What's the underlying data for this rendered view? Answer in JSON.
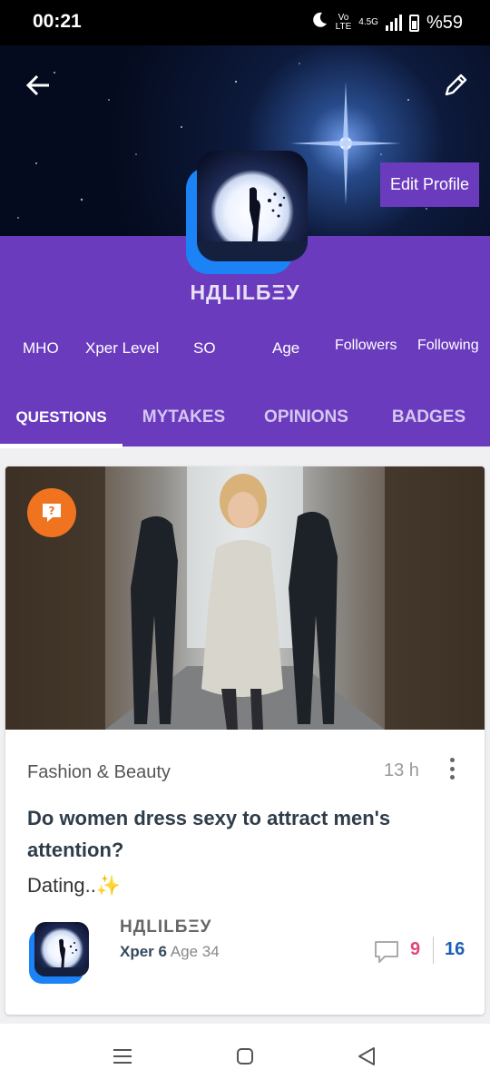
{
  "status_bar": {
    "time": "00:21",
    "volte_top": "Vo",
    "volte_bottom": "LTE",
    "network": "4.5G",
    "battery": "%59"
  },
  "header": {
    "back_icon": "arrow-left-icon",
    "edit_icon": "pencil-icon",
    "edit_profile_label": "Edit Profile"
  },
  "profile": {
    "username": "НДLILБΞУ",
    "stats": [
      "MHO",
      "Xper Level",
      "SO",
      "Age",
      "Followers",
      "Following"
    ]
  },
  "tabs": [
    "QUESTIONS",
    "MYTAKES",
    "OPINIONS",
    "BADGES"
  ],
  "post": {
    "badge_icon": "question-chat-icon",
    "category": "Fashion & Beauty",
    "time": "13 h",
    "title": "Do women dress sexy to attract men's attention?",
    "description": "Dating..✨",
    "author": {
      "name": "НДLILБΞУ",
      "level": "Xper 6",
      "age": "Age 34"
    },
    "comments": "9",
    "votes": "16"
  },
  "nav": {
    "menu_icon": "menu-icon",
    "home_icon": "home-square-icon",
    "back_icon": "back-triangle-icon"
  },
  "colors": {
    "accent": "#6a3bbd",
    "badge": "#f0731f",
    "comment_count": "#e0457b",
    "vote_count": "#1a5fb4",
    "avatar_shadow": "#1b83f5"
  }
}
